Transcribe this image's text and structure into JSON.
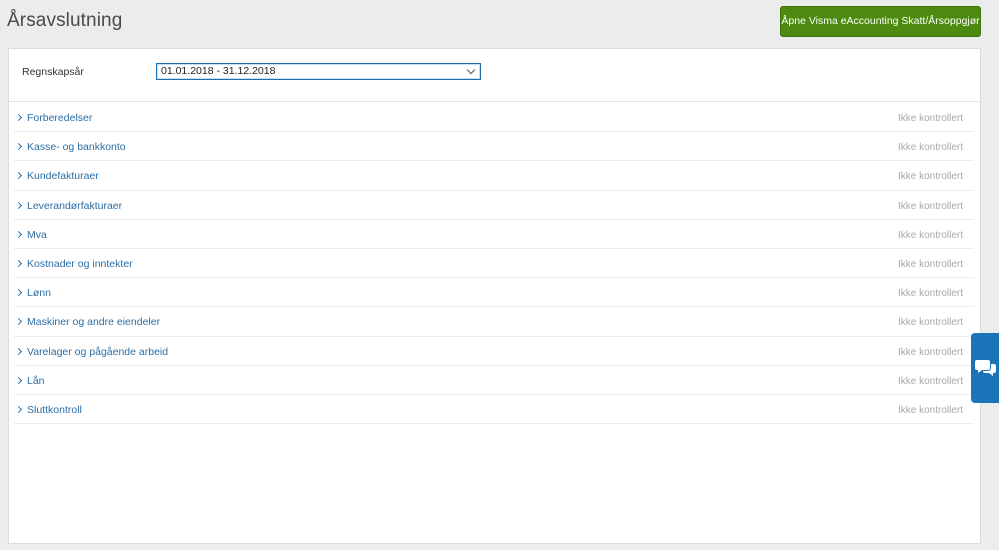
{
  "header": {
    "title": "Årsavslutning",
    "open_button_label": "Åpne Visma eAccounting Skatt/Årsoppgjør"
  },
  "filter": {
    "label": "Regnskapsår",
    "selected_year": "01.01.2018 - 31.12.2018"
  },
  "sections": [
    {
      "label": "Forberedelser",
      "status": "Ikke kontrollert"
    },
    {
      "label": "Kasse- og bankkonto",
      "status": "Ikke kontrollert"
    },
    {
      "label": "Kundefakturaer",
      "status": "Ikke kontrollert"
    },
    {
      "label": "Leverandørfakturaer",
      "status": "Ikke kontrollert"
    },
    {
      "label": "Mva",
      "status": "Ikke kontrollert"
    },
    {
      "label": "Kostnader og inntekter",
      "status": "Ikke kontrollert"
    },
    {
      "label": "Lønn",
      "status": "Ikke kontrollert"
    },
    {
      "label": "Maskiner og andre eiendeler",
      "status": "Ikke kontrollert"
    },
    {
      "label": "Varelager og pågående arbeid",
      "status": "Ikke kontrollert"
    },
    {
      "label": "Lån",
      "status": "Ikke kontrollert"
    },
    {
      "label": "Sluttkontroll",
      "status": "Ikke kontrollert"
    }
  ],
  "chat": {
    "icon": "chat-bubbles-icon"
  },
  "colors": {
    "primary_button": "#4c8b0f",
    "link": "#2b6ea5",
    "chat_tab": "#1b74b7",
    "status_muted": "#a8a8a8"
  }
}
